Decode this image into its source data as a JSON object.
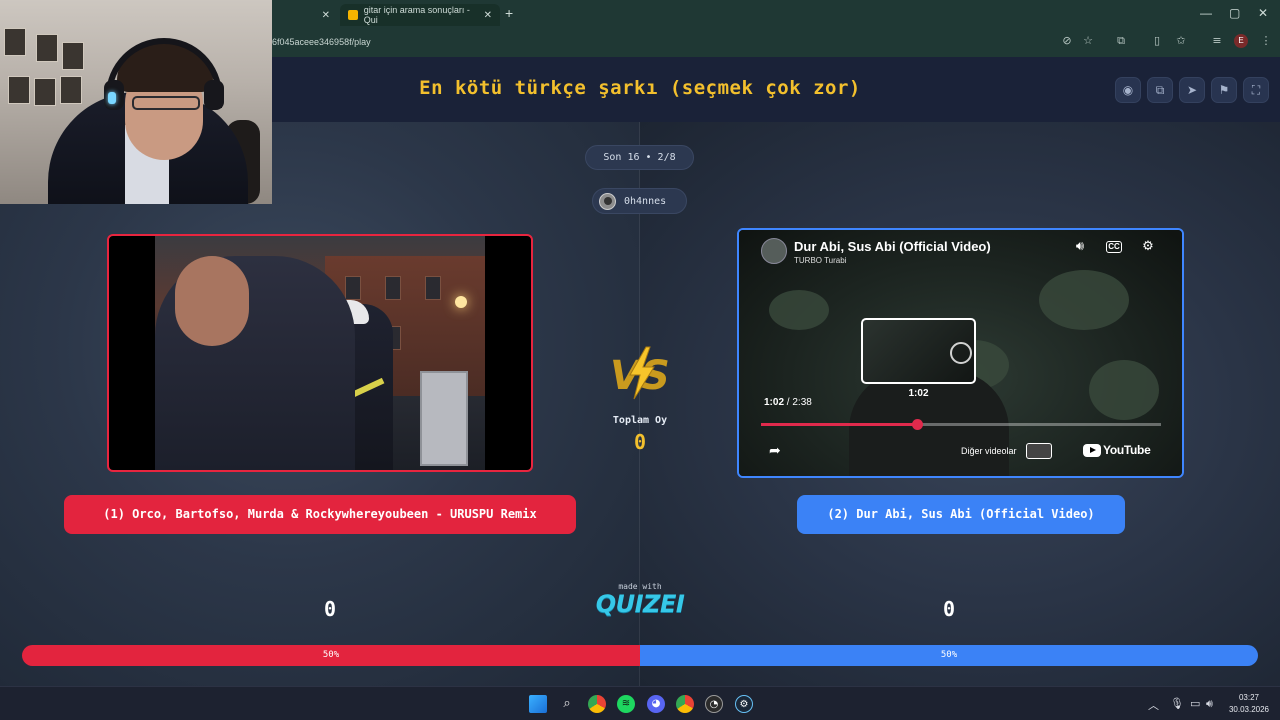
{
  "browser": {
    "tabs": [
      {
        "label": "",
        "close": "✕"
      },
      {
        "label": "gitar için arama sonuçları - Qui",
        "close": "✕"
      }
    ],
    "new_tab": "+",
    "window_controls": [
      "—",
      "▢",
      "✕"
    ],
    "url": "6f045aceee346958f/play",
    "profile_initial": "E",
    "toolbar_icons": [
      "eye-off-icon",
      "star-icon",
      "extensions-icon",
      "trash-icon",
      "bookmark-star-icon",
      "tab-search-icon",
      "profile-icon",
      "menu-icon"
    ]
  },
  "header": {
    "title": "En kötü türkçe şarkı (seçmek çok zor)",
    "buttons": [
      "eye-icon",
      "copy-icon",
      "send-icon",
      "flag-icon",
      "fullscreen-icon"
    ]
  },
  "round": {
    "label": "Son 16 • 2/8"
  },
  "user": {
    "name": "0h4nnes"
  },
  "left": {
    "option_label": "(1) Orco, Bartofso, Murda & Rockywhereyoubeen - URUSPU Remix",
    "votes": "0",
    "percent_label": "50%",
    "percent": 50
  },
  "right": {
    "option_label": "(2) Dur Abi, Sus Abi (Official Video)",
    "votes": "0",
    "percent_label": "50%",
    "percent": 50,
    "player": {
      "title": "Dur Abi, Sus Abi (Official Video)",
      "channel": "TURBO Turabi",
      "cc": "CC",
      "current_time": "1:02",
      "duration": "2:38",
      "time_separator": " / ",
      "preview_time": "1:02",
      "progress": 0.39,
      "more_videos": "Diğer videolar",
      "logo_text": "YouTube"
    }
  },
  "center": {
    "total_label": "Toplam Oy",
    "total_count": "0",
    "made_with": "made with",
    "brand": "QUIZEI"
  },
  "colors": {
    "left_accent": "#e3243e",
    "right_accent": "#3b82f6",
    "title_color": "#f3c02d",
    "brand_color": "#36c8e8"
  },
  "taskbar": {
    "clock_time": "03:27",
    "clock_date": "30.03.2026"
  }
}
